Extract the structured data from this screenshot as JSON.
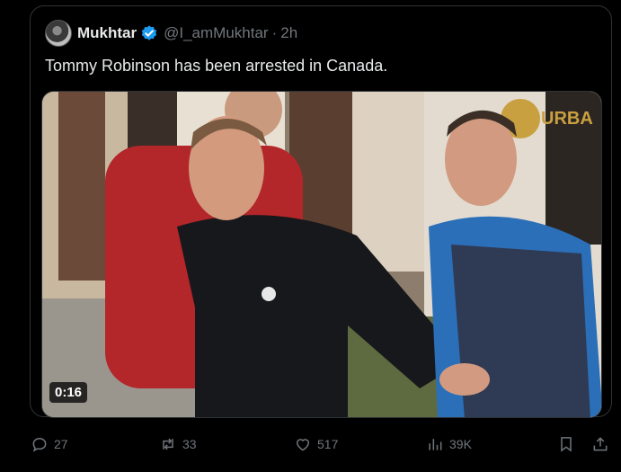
{
  "tweet": {
    "author_name": "Mukhtar",
    "author_handle": "@I_amMukhtar",
    "separator": "·",
    "time": "2h",
    "text": "Tommy Robinson has been arrested in Canada.",
    "video_duration": "0:16",
    "video_sign_text": "URBA"
  },
  "actions": {
    "replies": "27",
    "reposts": "33",
    "likes": "517",
    "views": "39K"
  },
  "colors": {
    "background": "#000000",
    "border": "#2f3336",
    "text": "#e7e9ea",
    "muted": "#71767b",
    "verified": "#1d9bf0"
  },
  "icons": [
    "verified-badge-icon",
    "reply-icon",
    "repost-icon",
    "like-icon",
    "views-icon",
    "bookmark-icon",
    "share-icon"
  ]
}
